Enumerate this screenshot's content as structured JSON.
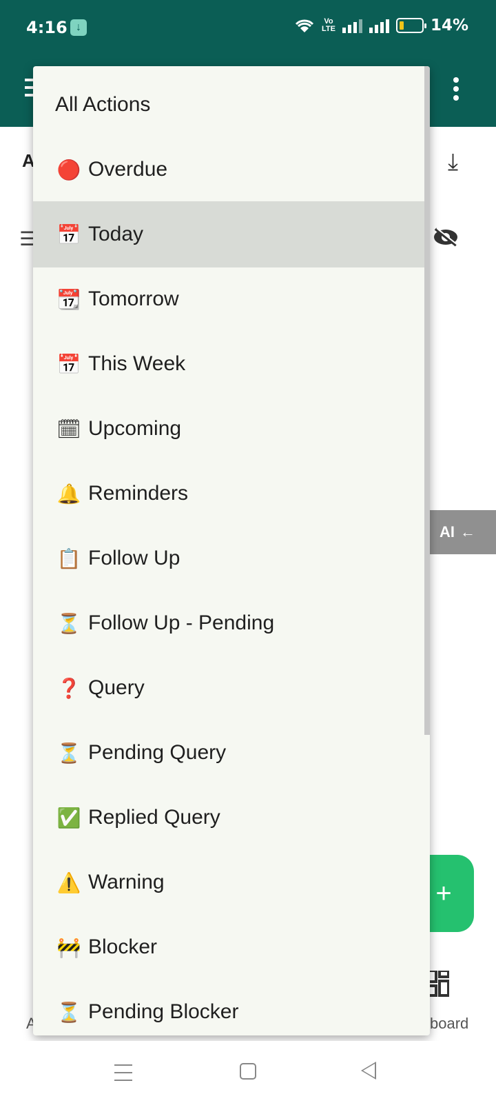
{
  "status_bar": {
    "time": "4:16",
    "battery_percent": "14%",
    "network_label": "Vo\nLTE"
  },
  "background": {
    "header_letter": "A",
    "ai_tab_label": "AI",
    "bottom_left_letter": "A",
    "bottom_right_label": "board"
  },
  "dropdown": {
    "selected_index": 2,
    "items": [
      {
        "icon": "",
        "label": "All Actions"
      },
      {
        "icon": "🔴",
        "label": "Overdue"
      },
      {
        "icon": "📅",
        "label": "Today"
      },
      {
        "icon": "📆",
        "label": "Tomorrow"
      },
      {
        "icon": "📅",
        "label": "This Week"
      },
      {
        "icon": "🗓",
        "label": "Upcoming"
      },
      {
        "icon": "🔔",
        "label": "Reminders"
      },
      {
        "icon": "📋",
        "label": "Follow Up"
      },
      {
        "icon": "⏳",
        "label": "Follow Up - Pending"
      },
      {
        "icon": "❓",
        "label": "Query"
      },
      {
        "icon": "⏳",
        "label": "Pending Query"
      },
      {
        "icon": "✅",
        "label": "Replied Query"
      },
      {
        "icon": "⚠️",
        "label": "Warning"
      },
      {
        "icon": "🚧",
        "label": "Blocker"
      },
      {
        "icon": "⏳",
        "label": "Pending Blocker"
      }
    ]
  },
  "colors": {
    "app_bar": "#0b5e55",
    "fab": "#25c16f",
    "menu_bg": "#f6f8f2",
    "selected_bg": "#d8dbd6"
  }
}
